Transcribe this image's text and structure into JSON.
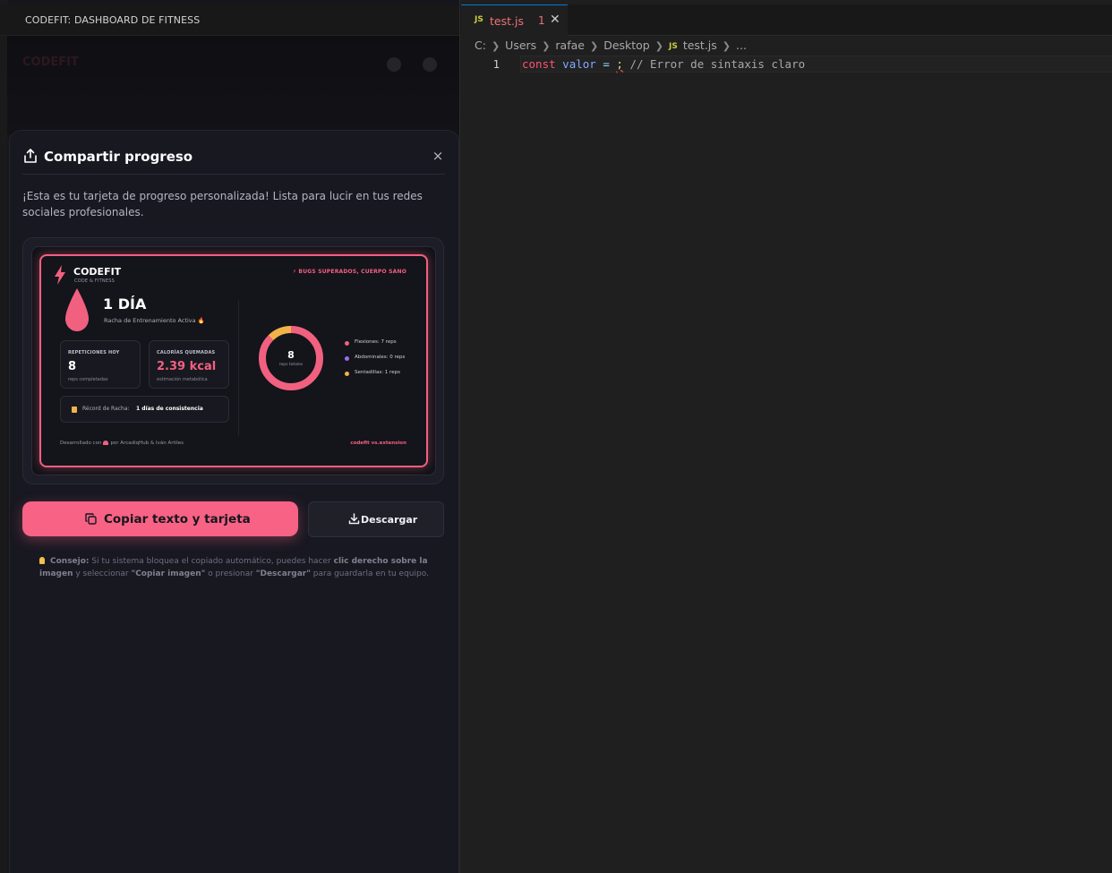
{
  "panel": {
    "title": "CODEFIT: DASHBOARD DE FITNESS",
    "background_logo": "CODEFIT"
  },
  "modal": {
    "title": "Compartir progreso",
    "close_label": "×",
    "description": "¡Esta es tu tarjeta de progreso personalizada! Lista para lucir en tus redes sociales profesionales."
  },
  "card": {
    "brand": "CODEFIT",
    "brand_sub": "CODE & FITNESS",
    "tagline": "BUGS SUPERADOS, CUERPO SANO",
    "streak_value": "1 DÍA",
    "streak_label": "Racha de Entrenamiento Activa 🔥",
    "stats": [
      {
        "label": "REPETICIONES HOY",
        "value": "8",
        "sub": "reps completadas"
      },
      {
        "label": "CALORÍAS QUEMADAS",
        "value": "2.39 kcal",
        "sub": "estimación metabólica"
      }
    ],
    "record_label": "Récord de Racha:",
    "record_value": "1 días de consistencia",
    "donut_total": "8",
    "donut_sub": "reps totales",
    "legend": [
      {
        "label": "Flexiones: 7 reps",
        "value": 7,
        "color": "#f2607f"
      },
      {
        "label": "Abdominales: 0 reps",
        "value": 0,
        "color": "#9b6cf2"
      },
      {
        "label": "Sentadillas: 1 reps",
        "value": 1,
        "color": "#f2b24a"
      }
    ],
    "footer_prefix": "Desarrollado con",
    "footer_suffix": "por ArcadiqHub & Iván Artiles",
    "footer_right": "codefit vs.extension",
    "accent": "#f2607f"
  },
  "actions": {
    "copy_label": "Copiar texto y tarjeta",
    "download_label": "Descargar"
  },
  "tip": {
    "label": "Consejo:",
    "text1": " Si tu sistema bloquea el copiado automático, puedes hacer ",
    "bold1": "clic derecho sobre la imagen",
    "text2": " y seleccionar ",
    "bold2": "\"Copiar imagen\"",
    "text3": " o presionar ",
    "bold3": "\"Descargar\"",
    "text4": " para guardarla en tu equipo."
  },
  "editor": {
    "tab": {
      "badge": "JS",
      "name": "test.js",
      "problems": "1",
      "close": "✕"
    },
    "breadcrumb": [
      "C:",
      "Users",
      "rafae",
      "Desktop",
      "test.js",
      "..."
    ],
    "breadcrumb_badge": "JS",
    "line_number": "1",
    "code": {
      "kw": "const",
      "var": "valor",
      "op": " = ",
      "err": ";",
      "comment": " // Error de sintaxis claro"
    }
  }
}
